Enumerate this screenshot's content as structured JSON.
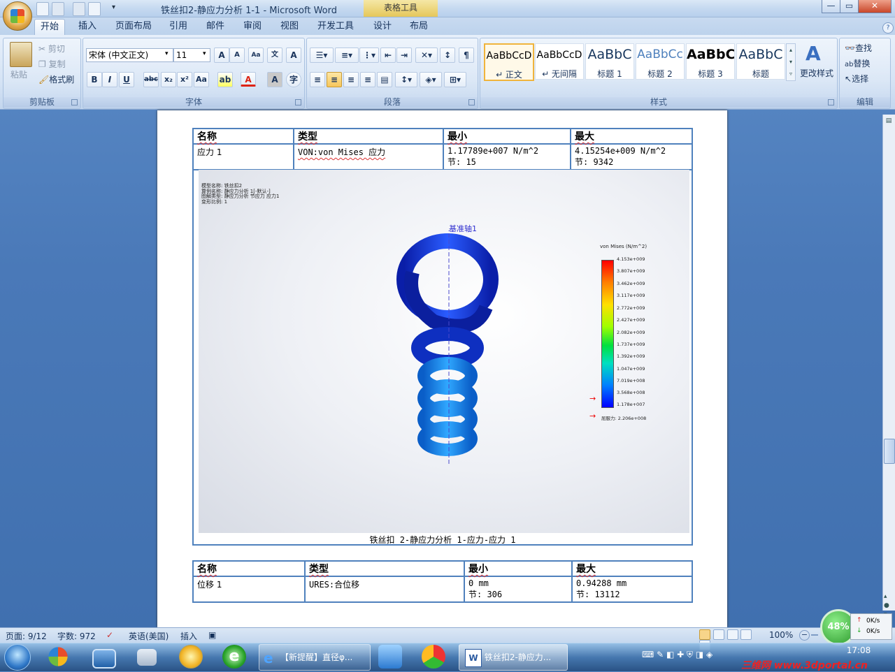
{
  "window": {
    "title": "铁丝扣2-静应力分析 1-1 - Microsoft Word",
    "context_tab": "表格工具",
    "buttons": {
      "minimize": "—",
      "maximize": "▭",
      "close": "✕"
    }
  },
  "ribbon_tabs": [
    "开始",
    "插入",
    "页面布局",
    "引用",
    "邮件",
    "审阅",
    "视图",
    "开发工具",
    "设计",
    "布局"
  ],
  "clipboard": {
    "paste": "粘贴",
    "cut": "剪切",
    "copy": "复制",
    "format_painter": "格式刷",
    "label": "剪贴板"
  },
  "font": {
    "name": "宋体 (中文正文)",
    "size": "11",
    "label": "字体"
  },
  "paragraph": {
    "label": "段落"
  },
  "styles": {
    "label": "样式",
    "items": [
      {
        "sample": "AaBbCcD",
        "name": "↵ 正文"
      },
      {
        "sample": "AaBbCcD",
        "name": "↵ 无间隔"
      },
      {
        "sample": "AaBbC",
        "name": "标题 1"
      },
      {
        "sample": "AaBbCc",
        "name": "标题 2"
      },
      {
        "sample": "AaBbC",
        "name": "标题 3"
      },
      {
        "sample": "AaBbC",
        "name": "标题"
      }
    ],
    "change_styles": "更改样式"
  },
  "editing": {
    "find": "查找",
    "replace": "替换",
    "select": "选择",
    "label": "编辑"
  },
  "doc": {
    "table1": {
      "headers": [
        "名称",
        "类型",
        "最小",
        "最大"
      ],
      "row": [
        "应力 1",
        "VON:von Mises  应力",
        "1.17789e+007 N/m^2",
        "4.15254e+009 N/m^2"
      ],
      "row_nodes": [
        "",
        "",
        "节: 15",
        "节: 9342"
      ]
    },
    "figure": {
      "meta": [
        "模型名称: 铁丝扣2",
        "算例名称: 静应力分析 1[-默认-]",
        "图解类型: 静应力分析 节应力 应力1",
        "变形比例: 1"
      ],
      "axis_label": "基准轴1",
      "legend_title": "von Mises (N/m^2)",
      "legend_ticks": [
        "4.153e+009",
        "3.807e+009",
        "3.462e+009",
        "3.117e+009",
        "2.772e+009",
        "2.427e+009",
        "2.082e+009",
        "1.737e+009",
        "1.392e+009",
        "1.047e+009",
        "7.019e+008",
        "3.568e+008",
        "1.178e+007"
      ],
      "yield": "屈服力: 2.206e+008",
      "caption": "铁丝扣 2-静应力分析 1-应力-应力 1"
    },
    "table2": {
      "headers": [
        "名称",
        "类型",
        "最小",
        "最大"
      ],
      "row": [
        "位移 1",
        "URES:合位移",
        "0 mm",
        "0.94288 mm"
      ],
      "row_nodes": [
        "",
        "",
        "节: 306",
        "节: 13112"
      ]
    }
  },
  "statusbar": {
    "page": "页面: 9/12",
    "words": "字数: 972",
    "language": "英语(美国)",
    "mode": "插入",
    "zoom": "100%"
  },
  "taskbar": {
    "task1": "【新提醒】直径φ...",
    "task2": "铁丝扣2-静应力...",
    "time": "17:08",
    "net_percent": "48%",
    "up": "0K/s",
    "down": "0K/s",
    "watermark": "三维网 www.3dportal.cn"
  }
}
